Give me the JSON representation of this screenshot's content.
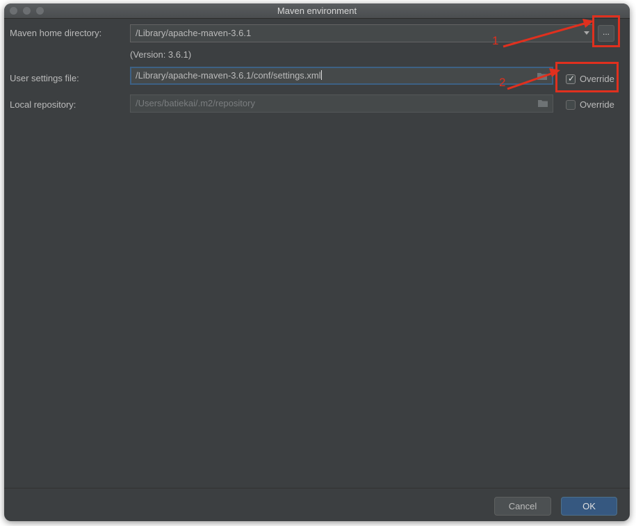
{
  "window": {
    "title": "Maven environment"
  },
  "maven_home": {
    "label": "Maven home directory:",
    "value": "/Library/apache-maven-3.6.1",
    "version": "(Version: 3.6.1)",
    "browse_label": "..."
  },
  "user_settings": {
    "label": "User settings file:",
    "value": "/Library/apache-maven-3.6.1/conf/settings.xml",
    "override_label": "Override",
    "override_checked": true
  },
  "local_repo": {
    "label": "Local repository:",
    "value": "/Users/batiekai/.m2/repository",
    "override_label": "Override",
    "override_checked": false
  },
  "buttons": {
    "cancel": "Cancel",
    "ok": "OK"
  },
  "annotations": {
    "step1": "1",
    "step2": "2",
    "color": "#e0301e"
  },
  "colors": {
    "background": "#3c3f41",
    "field": "#45494a",
    "focus": "#3d6185",
    "ok_button": "#365880"
  }
}
